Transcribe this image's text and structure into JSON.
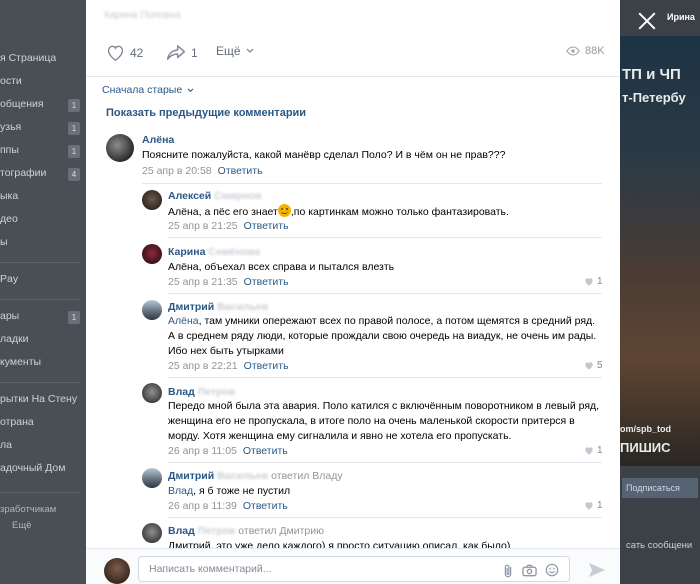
{
  "background": {
    "nav_items": [
      "я Страница",
      "ости",
      "общения",
      "узья",
      "ппы",
      "тографии",
      "ыка",
      "део",
      "ы",
      "Pay",
      "ары",
      "ладки",
      "кументы",
      "рытки На Стену",
      "отрана",
      "ла",
      "адочный Дом"
    ],
    "badges": [
      "1",
      "1",
      "1",
      "4",
      "1"
    ],
    "footer_links": [
      "зработчикам",
      "Ещё"
    ],
    "right_name": "Ирина",
    "photo_text": [
      "ТП и ЧП",
      "т-Петербу",
      "om/spb_tod",
      "ПИШИС"
    ],
    "subscribe_label": "Подписаться",
    "send_message_label": "сать сообщени"
  },
  "post": {
    "author": "Карина Поповна",
    "likes_count": "42",
    "shares_count": "1",
    "more_label": "Ещё",
    "views_count": "88K"
  },
  "comments_header": {
    "sort_label": "Сначала старые",
    "show_previous_label": "Показать предыдущие комментарии"
  },
  "comments": [
    {
      "name": "Алёна",
      "text": "Поясните пожалуйста, какой манёвр сделал Поло? И в чём он не прав???",
      "date": "25 апр в 20:58",
      "reply": "Ответить"
    },
    {
      "name": "Алексей",
      "name_blurred": "Смирнов",
      "text_before": "Алёна, а пёс его знает",
      "text_after": ",по картинкам можно только фантазировать.",
      "date": "25 апр в 21:25",
      "reply": "Ответить"
    },
    {
      "name": "Карина",
      "name_blurred": "Семёнова",
      "text": "Алёна, объехал всех справа и пытался влезть",
      "date": "25 апр в 21:35",
      "reply": "Ответить",
      "likes": "1"
    },
    {
      "name": "Дмитрий",
      "name_blurred": "Васильев",
      "mention": "Алёна",
      "text": ", там умники опережают всех по правой полосе, а потом щемятся в средний ряд. А в среднем ряду люди, которые прождали свою очередь на виадук, не очень им рады. Ибо нех быть утырками",
      "date": "25 апр в 22:21",
      "reply": "Ответить",
      "likes": "5"
    },
    {
      "name": "Влад",
      "name_blurred": "Петров",
      "text": "Передо мной была эта авария. Поло катился с включённым поворотником в левый ряд, женщина его не пропускала, в итоге поло на очень маленькой скорости притерся в морду. Хотя женщина ему сигналила и явно не хотела его пропускать.",
      "date": "26 апр в 11:05",
      "reply": "Ответить",
      "likes": "1"
    },
    {
      "name": "Дмитрий",
      "name_blurred": "Васильев",
      "answered": "ответил Владу",
      "mention": "Влад",
      "text": ", я б тоже не пустил",
      "date": "26 апр в 11:39",
      "reply": "Ответить",
      "likes": "1"
    },
    {
      "name": "Влад",
      "name_blurred": "Петров",
      "answered": "ответил Дмитрию",
      "text": "Дмитрий, это уже дело каждого) я просто ситуацию описал, как было)"
    }
  ],
  "composer": {
    "placeholder": "Написать комментарий..."
  },
  "colors": {
    "link": "#2a5885",
    "meta": "#939393",
    "accent_emoji": "#f5b301"
  }
}
